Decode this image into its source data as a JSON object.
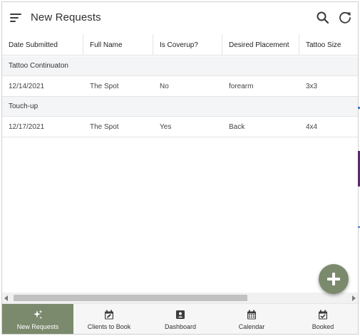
{
  "app": {
    "title": "New Requests"
  },
  "colors": {
    "accent": "#7b8a6c",
    "group_bg": "#f4f5f7"
  },
  "table": {
    "headers": [
      "Date Submitted",
      "Full Name",
      "Is Coverup?",
      "Desired Placement",
      "Tattoo Size"
    ],
    "groups": [
      {
        "label": "Tattoo Continuaton",
        "rows": [
          [
            "12/14/2021",
            "The Spot",
            "No",
            "forearm",
            "3x3"
          ]
        ]
      },
      {
        "label": "Touch-up",
        "rows": [
          [
            "12/17/2021",
            "The Spot",
            "Yes",
            "Back",
            "4x4"
          ]
        ]
      }
    ]
  },
  "fab": {
    "icon": "plus-icon"
  },
  "nav": {
    "items": [
      {
        "label": "New Requests",
        "icon": "sparkle-icon",
        "active": true
      },
      {
        "label": "Clients to Book",
        "icon": "calendar-edit-icon",
        "active": false
      },
      {
        "label": "Dashboard",
        "icon": "dashboard-icon",
        "active": false
      },
      {
        "label": "Calendar",
        "icon": "calendar-icon",
        "active": false
      },
      {
        "label": "Booked",
        "icon": "calendar-check-icon",
        "active": false
      }
    ]
  }
}
